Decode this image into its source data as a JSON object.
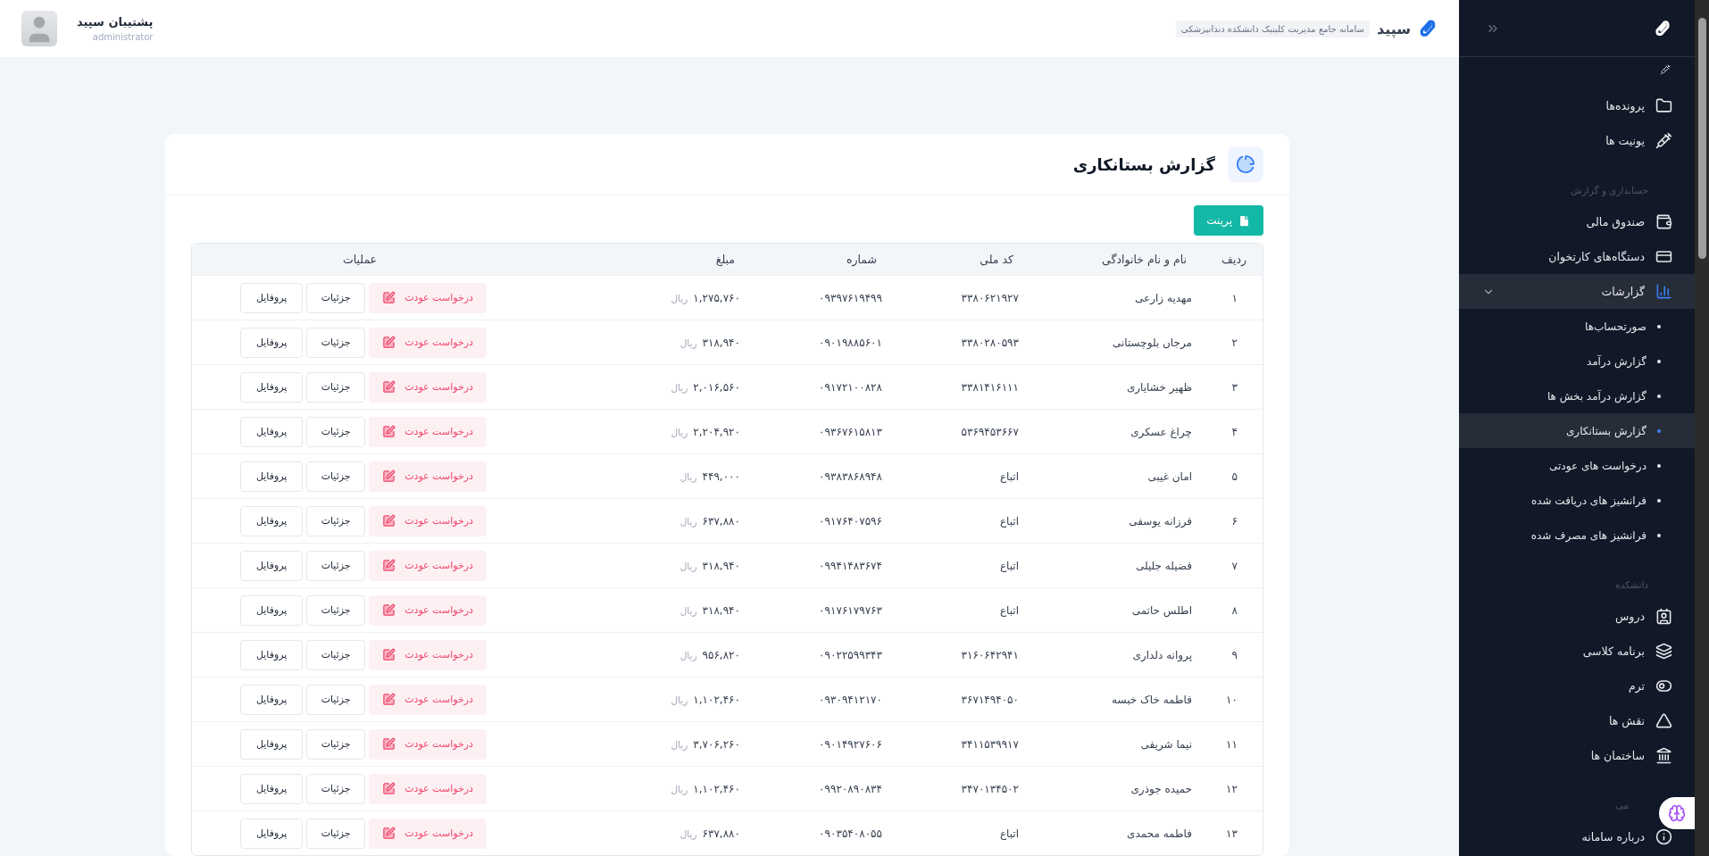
{
  "header": {
    "app_name": "سپید",
    "app_subtitle": "سامانه جامع مدیریت کلینیک دانشکده دندانپزشکی",
    "user": {
      "name": "پشتیبان سپید",
      "role": "administrator"
    }
  },
  "sidebar": {
    "groups": [
      {
        "items": [
          {
            "label": "پرونده‌ها"
          },
          {
            "label": "یونیت ها"
          }
        ]
      },
      {
        "title": "حسابداری و گزارش",
        "items": [
          {
            "label": "صندوق مالی"
          },
          {
            "label": "دستگاه‌های کارتخوان"
          },
          {
            "label": "گزارشات",
            "expanded": true,
            "children": [
              {
                "label": "صورتحساب‌ها",
                "selected": false
              },
              {
                "label": "گزارش درآمد",
                "selected": false
              },
              {
                "label": "گزارش درآمد بخش ها",
                "selected": false
              },
              {
                "label": "گزارش بستانکاری",
                "selected": true
              },
              {
                "label": "درخواست های عودتی",
                "selected": false
              },
              {
                "label": "فرانشیز های دریافت شده",
                "selected": false
              },
              {
                "label": "فرانشیز های مصرف شده",
                "selected": false
              }
            ]
          }
        ]
      },
      {
        "title": "دانشکده",
        "items": [
          {
            "label": "دروس"
          },
          {
            "label": "برنامه کلاسی"
          },
          {
            "label": "ترم"
          },
          {
            "label": "نقش ها"
          },
          {
            "label": "ساختمان ها"
          }
        ]
      },
      {
        "title": "می",
        "items": [
          {
            "label": "درباره سامانه"
          }
        ]
      }
    ]
  },
  "page": {
    "title": "گزارش بستانکاری",
    "print_button": "پرینت"
  },
  "table": {
    "columns": [
      "ردیف",
      "نام و نام خانوادگی",
      "کد ملی",
      "شماره",
      "مبلغ",
      "عملیات"
    ],
    "rows": [
      {
        "index": "۱",
        "name": "مهدیه زارعی",
        "national_id": "۳۳۸۰۶۲۱۹۲۷",
        "phone": "۰۹۳۹۷۶۱۹۴۹۹",
        "amount": "۱,۲۷۵,۷۶۰",
        "currency": "ریال",
        "actions": [
          {
            "kind": "refund",
            "label": "درخواست عودت"
          },
          {
            "kind": "details",
            "label": "جزئیات"
          },
          {
            "kind": "profile",
            "label": "پروفایل"
          }
        ]
      },
      {
        "index": "۲",
        "name": "مرجان بلوچستانی",
        "national_id": "۳۳۸۰۲۸۰۵۹۳",
        "phone": "۰۹۰۱۹۸۸۵۶۰۱",
        "amount": "۳۱۸,۹۴۰",
        "currency": "ریال",
        "actions": [
          {
            "kind": "refund",
            "label": "درخواست عودت"
          },
          {
            "kind": "details",
            "label": "جزئیات"
          },
          {
            "kind": "profile",
            "label": "پروفایل"
          }
        ]
      },
      {
        "index": "۳",
        "name": "ظهیر خشایاری",
        "national_id": "۳۳۸۱۴۱۶۱۱۱",
        "phone": "۰۹۱۷۲۱۰۰۸۲۸",
        "amount": "۲,۰۱۶,۵۶۰",
        "currency": "ریال",
        "actions": [
          {
            "kind": "refund",
            "label": "درخواست عودت"
          },
          {
            "kind": "details",
            "label": "جزئیات"
          },
          {
            "kind": "profile",
            "label": "پروفایل"
          }
        ]
      },
      {
        "index": "۴",
        "name": "چراغ عسکری",
        "national_id": "۵۳۶۹۴۵۳۶۶۷",
        "phone": "۰۹۳۶۷۶۱۵۸۱۳",
        "amount": "۲,۲۰۴,۹۲۰",
        "currency": "ریال",
        "actions": [
          {
            "kind": "refund",
            "label": "درخواست عودت"
          },
          {
            "kind": "details",
            "label": "جزئیات"
          },
          {
            "kind": "profile",
            "label": "پروفایل"
          }
        ]
      },
      {
        "index": "۵",
        "name": "امان غیبی",
        "national_id": "اتباع",
        "phone": "۰۹۳۸۳۸۶۸۹۴۸",
        "amount": "۴۴۹,۰۰۰",
        "currency": "ریال",
        "actions": [
          {
            "kind": "refund",
            "label": "درخواست عودت"
          },
          {
            "kind": "details",
            "label": "جزئیات"
          },
          {
            "kind": "profile",
            "label": "پروفایل"
          }
        ]
      },
      {
        "index": "۶",
        "name": "فرزانه یوسفی",
        "national_id": "اتباع",
        "phone": "۰۹۱۷۶۴۰۷۵۹۶",
        "amount": "۶۳۷,۸۸۰",
        "currency": "ریال",
        "actions": [
          {
            "kind": "refund",
            "label": "درخواست عودت"
          },
          {
            "kind": "details",
            "label": "جزئیات"
          },
          {
            "kind": "profile",
            "label": "پروفایل"
          }
        ]
      },
      {
        "index": "۷",
        "name": "فضیله جلیلی",
        "national_id": "اتباع",
        "phone": "۰۹۹۴۱۴۸۳۶۷۴",
        "amount": "۳۱۸,۹۴۰",
        "currency": "ریال",
        "actions": [
          {
            "kind": "refund",
            "label": "درخواست عودت"
          },
          {
            "kind": "details",
            "label": "جزئیات"
          },
          {
            "kind": "profile",
            "label": "پروفایل"
          }
        ]
      },
      {
        "index": "۸",
        "name": "اطلس حاتمی",
        "national_id": "اتباع",
        "phone": "۰۹۱۷۶۱۷۹۷۶۳",
        "amount": "۳۱۸,۹۴۰",
        "currency": "ریال",
        "actions": [
          {
            "kind": "refund",
            "label": "درخواست عودت"
          },
          {
            "kind": "details",
            "label": "جزئیات"
          },
          {
            "kind": "profile",
            "label": "پروفایل"
          }
        ]
      },
      {
        "index": "۹",
        "name": "پروانه دلداری",
        "national_id": "۳۱۶۰۶۴۲۹۴۱",
        "phone": "۰۹۰۲۲۵۹۹۳۴۳",
        "amount": "۹۵۶,۸۲۰",
        "currency": "ریال",
        "actions": [
          {
            "kind": "refund",
            "label": "درخواست عودت"
          },
          {
            "kind": "details",
            "label": "جزئیات"
          },
          {
            "kind": "profile",
            "label": "پروفایل"
          }
        ]
      },
      {
        "index": "۱۰",
        "name": "فاطمه خاک خبسه",
        "national_id": "۳۶۷۱۴۹۴۰۵۰",
        "phone": "۰۹۳۰۹۴۱۲۱۷۰",
        "amount": "۱,۱۰۲,۴۶۰",
        "currency": "ریال",
        "actions": [
          {
            "kind": "refund",
            "label": "درخواست عودت"
          },
          {
            "kind": "details",
            "label": "جزئیات"
          },
          {
            "kind": "profile",
            "label": "پروفایل"
          }
        ]
      },
      {
        "index": "۱۱",
        "name": "نیما شریفی",
        "national_id": "۳۴۱۱۵۳۹۹۱۷",
        "phone": "۰۹۰۱۴۹۲۷۶۰۶",
        "amount": "۳,۷۰۶,۲۶۰",
        "currency": "ریال",
        "actions": [
          {
            "kind": "refund",
            "label": "درخواست عودت"
          },
          {
            "kind": "details",
            "label": "جزئیات"
          },
          {
            "kind": "profile",
            "label": "پروفایل"
          }
        ]
      },
      {
        "index": "۱۲",
        "name": "حمیده جوذری",
        "national_id": "۳۴۷۰۱۳۴۵۰۲",
        "phone": "۰۹۹۲۰۸۹۰۸۳۴",
        "amount": "۱,۱۰۲,۴۶۰",
        "currency": "ریال",
        "actions": [
          {
            "kind": "refund",
            "label": "درخواست عودت"
          },
          {
            "kind": "details",
            "label": "جزئیات"
          },
          {
            "kind": "profile",
            "label": "پروفایل"
          }
        ]
      },
      {
        "index": "۱۳",
        "name": "فاطمه محمدی",
        "national_id": "اتباع",
        "phone": "۰۹۰۳۵۴۰۸۰۵۵",
        "amount": "۶۳۷,۸۸۰",
        "currency": "ریال",
        "actions": [
          {
            "kind": "refund",
            "label": "درخواست عودت"
          },
          {
            "kind": "details",
            "label": "جزئیات"
          },
          {
            "kind": "profile",
            "label": "پروفایل"
          }
        ]
      }
    ]
  }
}
